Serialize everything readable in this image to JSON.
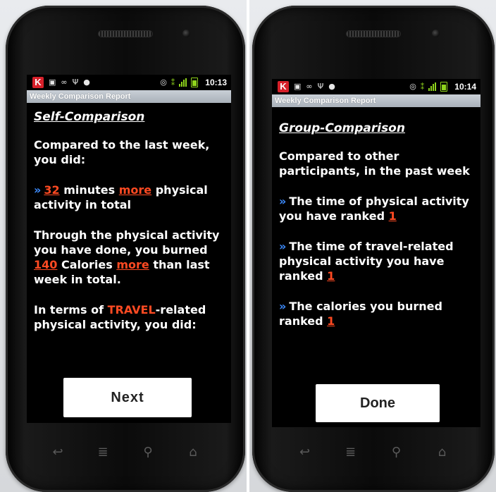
{
  "left": {
    "status": {
      "time": "10:13"
    },
    "title_bar": "Weekly Comparison Report",
    "heading": "Self-Comparison",
    "intro": "Compared to the last week, you did:",
    "item1": {
      "value": "32",
      "mid": "minutes",
      "keyword": "more",
      "tail": "physical activity in total"
    },
    "item2": {
      "prefix": "Through the physical activity you have done, you burned",
      "value": "140",
      "mid": "Calories",
      "keyword": "more",
      "tail": "than last week in total."
    },
    "item3": {
      "prefix": "In terms of",
      "keyword": "TRAVEL",
      "tail": "-related physical activity, you did:"
    },
    "button_label": "Next"
  },
  "right": {
    "status": {
      "time": "10:14"
    },
    "title_bar": "Weekly Comparison Report",
    "heading": "Group-Comparison",
    "intro": "Compared to other participants, in the past week",
    "items": [
      {
        "text": "The time of physical activity you have ranked",
        "rank": "1"
      },
      {
        "text": "The time of travel-related physical activity you have ranked",
        "rank": "1"
      },
      {
        "text": "The calories you burned ranked",
        "rank": "1"
      }
    ],
    "button_label": "Done"
  },
  "icons": {
    "status_left": [
      "k-app-icon",
      "bag-icon",
      "voicemail-icon",
      "usb-icon",
      "android-icon"
    ],
    "status_right": [
      "sync-icon",
      "wifi-icon",
      "signal-icon",
      "battery-icon"
    ],
    "nav": [
      "back-icon",
      "menu-icon",
      "search-icon",
      "home-icon"
    ],
    "bullet": "»"
  },
  "colors": {
    "highlight": "#ff4a22",
    "bullet": "#3d8cff",
    "title_bar": "#b4bcc5",
    "screen_bg": "#000000",
    "status_green": "#8fd41c"
  }
}
